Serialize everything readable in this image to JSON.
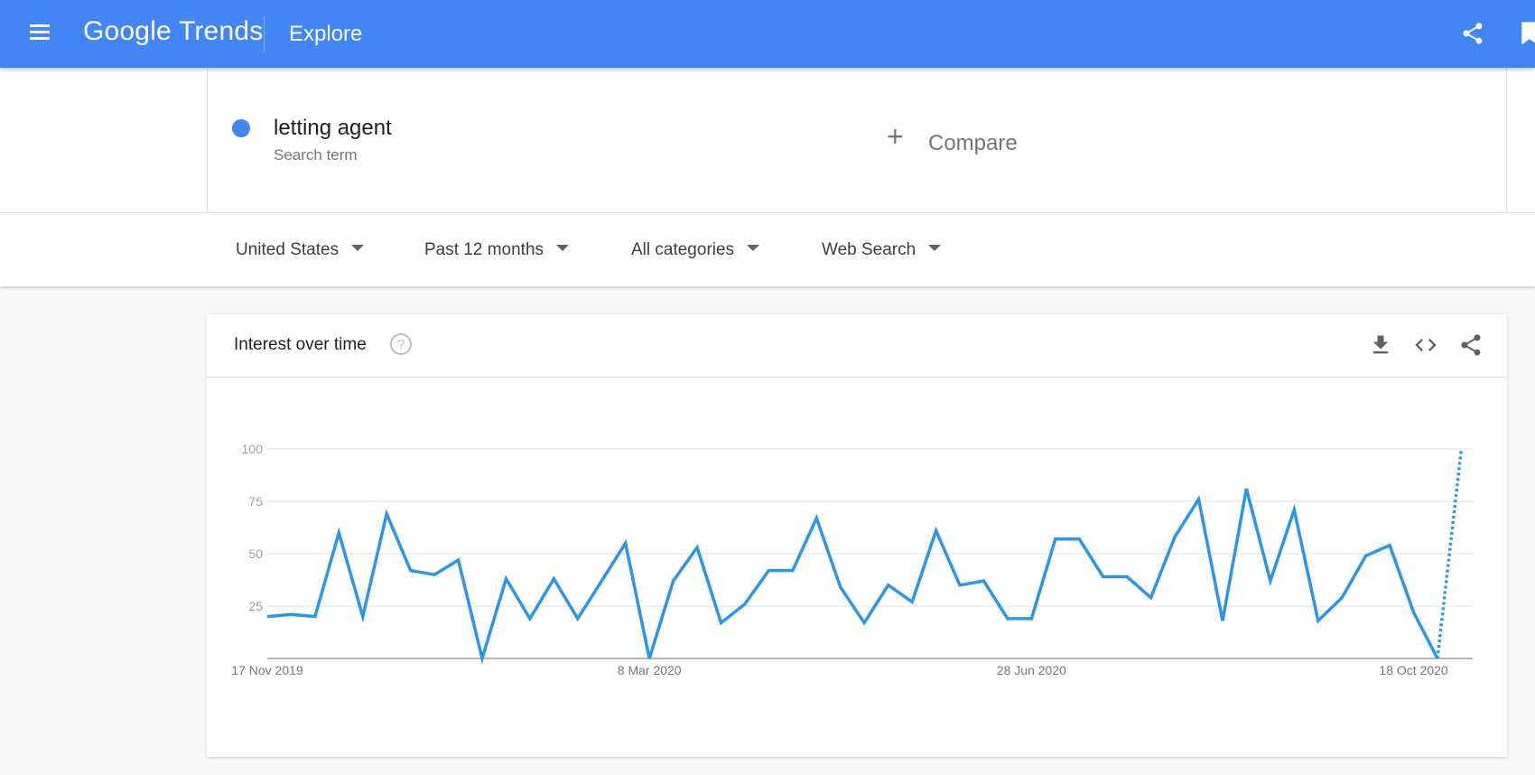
{
  "header": {
    "logo_google": "Google",
    "logo_trends": "Trends",
    "page_title": "Explore"
  },
  "search": {
    "term": "letting agent",
    "term_sub": "Search term",
    "term_color": "#4285f4",
    "compare_label": "Compare"
  },
  "filters": {
    "region": "United States",
    "time": "Past 12 months",
    "category": "All categories",
    "search_type": "Web Search"
  },
  "card": {
    "title": "Interest over time"
  },
  "chart_data": {
    "type": "line",
    "title": "Interest over time",
    "x_labels": [
      "17 Nov 2019",
      "8 Mar 2020",
      "28 Jun 2020",
      "18 Oct 2020"
    ],
    "y_ticks": [
      25,
      50,
      75,
      100
    ],
    "ylim": [
      0,
      100
    ],
    "grid": true,
    "series": [
      {
        "name": "letting agent",
        "color": "#2b96e8",
        "values": [
          20,
          21,
          20,
          60,
          20,
          69,
          42,
          40,
          47,
          0,
          38,
          19,
          38,
          19,
          37,
          55,
          0,
          37,
          53,
          17,
          26,
          42,
          42,
          67,
          34,
          17,
          35,
          27,
          61,
          35,
          37,
          19,
          19,
          57,
          57,
          39,
          39,
          29,
          58,
          76,
          18,
          81,
          37,
          71,
          18,
          29,
          49,
          54,
          22,
          0
        ],
        "partial_values": [
          0,
          100
        ]
      }
    ]
  }
}
